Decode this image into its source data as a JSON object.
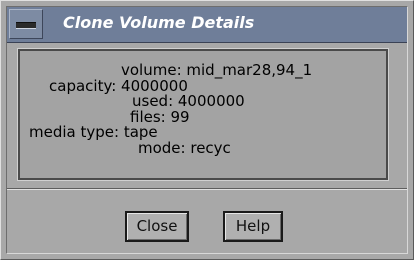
{
  "window": {
    "title": "Clone Volume Details"
  },
  "details": {
    "volume": "volume: mid_mar28,94_1",
    "capacity": "capacity: 4000000",
    "used": "used: 4000000",
    "files": "files: 99",
    "media_type": "media type: tape",
    "mode": "mode: recyc"
  },
  "buttons": {
    "close_label": "Close",
    "help_label": "Help"
  },
  "icons": {
    "window_menu": "window-menu-icon"
  },
  "colors": {
    "titlebar": "#6f7e99",
    "title_text": "#ffffff",
    "window_bg": "#a8a8a8"
  }
}
